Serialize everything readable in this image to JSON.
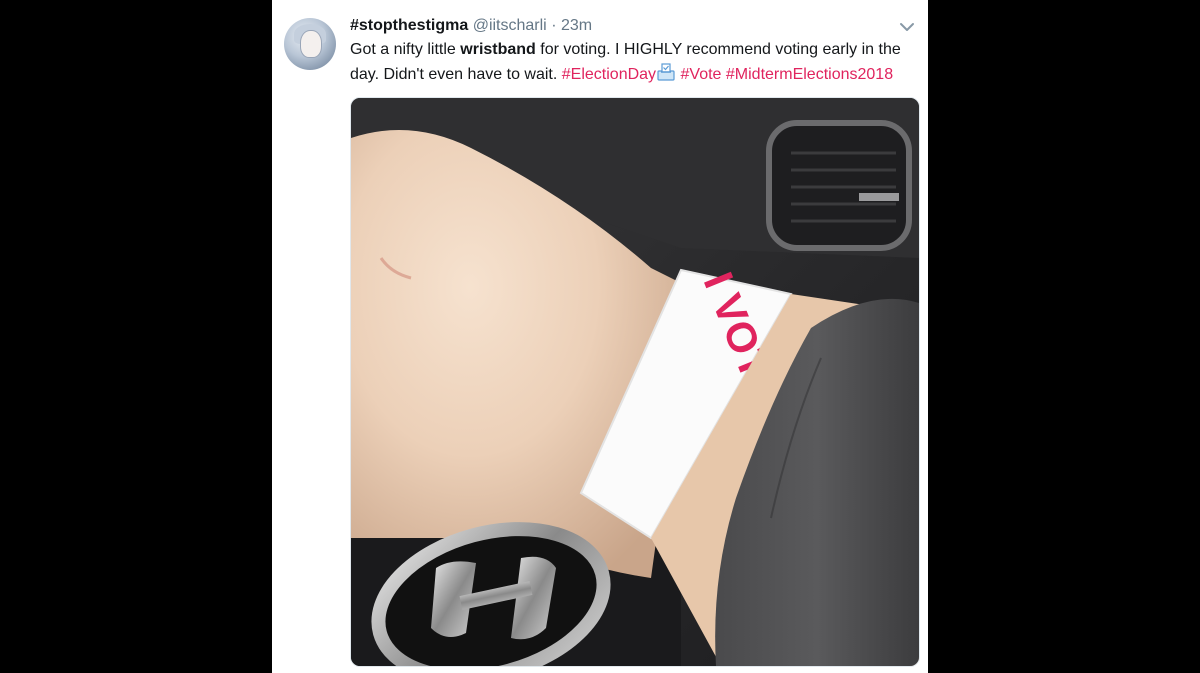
{
  "tweet": {
    "display_name": "#stopthestigma",
    "handle": "@iitscharli",
    "separator": "·",
    "time": "23m",
    "text_part1": "Got a nifty little ",
    "text_bold": "wristband",
    "text_part2": " for voting. I HIGHLY recommend voting early in the day. Didn't even have to wait. ",
    "hashtags": [
      "#ElectionDay",
      "#Vote",
      "#MidtermElections2018"
    ],
    "avatar_icon": "user-avatar",
    "menu_icon": "chevron-down-icon",
    "emoji_icon": "ballot-box-icon"
  },
  "media": {
    "wristband_text": "I VOTED TODAY",
    "accent_color": "#e0245e"
  }
}
